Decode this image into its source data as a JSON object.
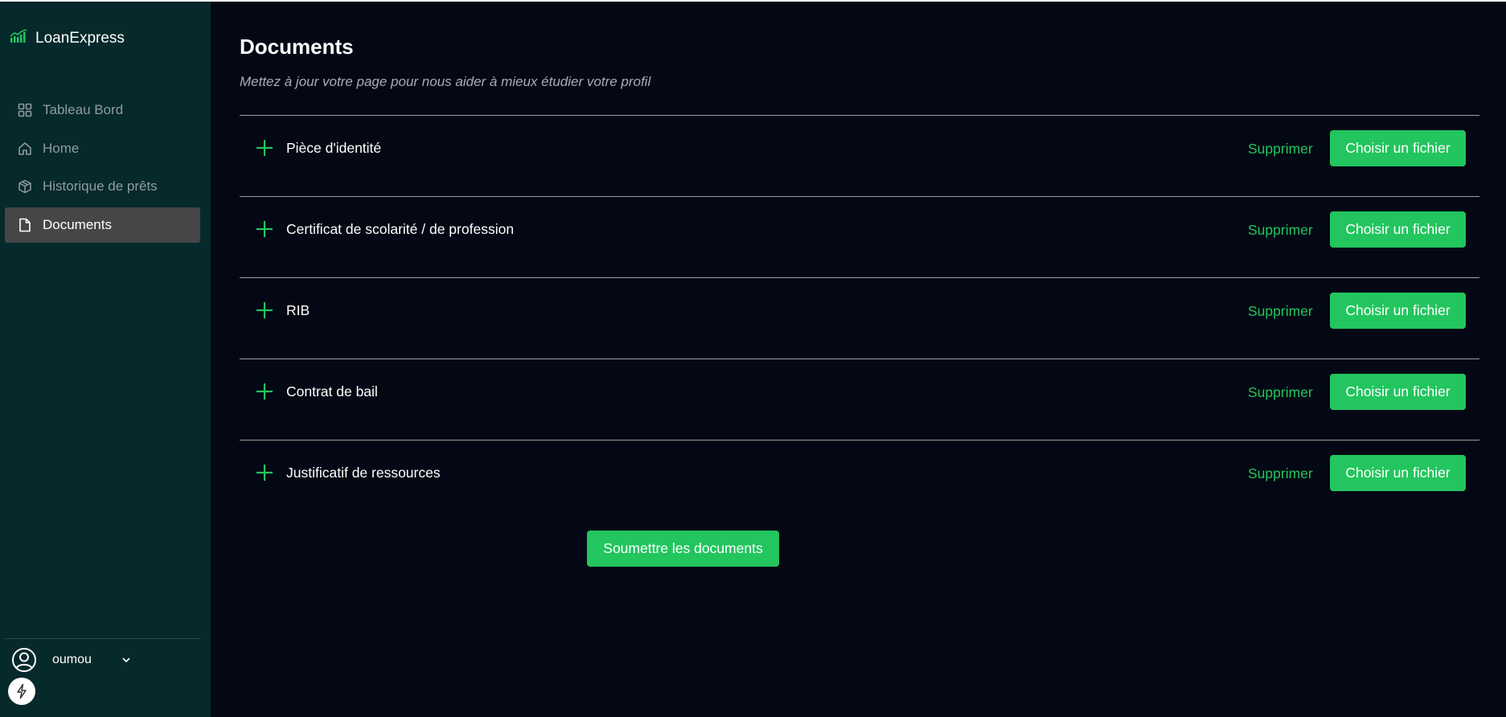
{
  "app": {
    "brand_name": "LoanExpress",
    "brand_icon": "bar-chart-icon"
  },
  "sidebar": {
    "items": [
      {
        "label": "Tableau Bord",
        "icon": "grid-icon",
        "active": false
      },
      {
        "label": "Home",
        "icon": "home-icon",
        "active": false
      },
      {
        "label": "Historique de prêts",
        "icon": "box-icon",
        "active": false
      },
      {
        "label": "Documents",
        "icon": "file-icon",
        "active": true
      }
    ],
    "user": {
      "name": "oumou",
      "icon": "user-circle-icon"
    }
  },
  "main": {
    "title": "Documents",
    "subtitle": "Mettez à jour votre page pour nous aider à mieux étudier votre profil",
    "documents": [
      {
        "label": "Pièce d'identité",
        "delete_label": "Supprimer",
        "choose_label": "Choisir un fichier"
      },
      {
        "label": "Certificat de scolarité / de profession",
        "delete_label": "Supprimer",
        "choose_label": "Choisir un fichier"
      },
      {
        "label": "RIB",
        "delete_label": "Supprimer",
        "choose_label": "Choisir un fichier"
      },
      {
        "label": "Contrat de bail",
        "delete_label": "Supprimer",
        "choose_label": "Choisir un fichier"
      },
      {
        "label": "Justificatif de ressources",
        "delete_label": "Supprimer",
        "choose_label": "Choisir un fichier"
      }
    ],
    "submit_label": "Soumettre les documents"
  },
  "colors": {
    "accent": "#22c55e",
    "sidebar_bg": "#06292b",
    "main_bg": "#040814",
    "active_item_bg": "#464646"
  }
}
